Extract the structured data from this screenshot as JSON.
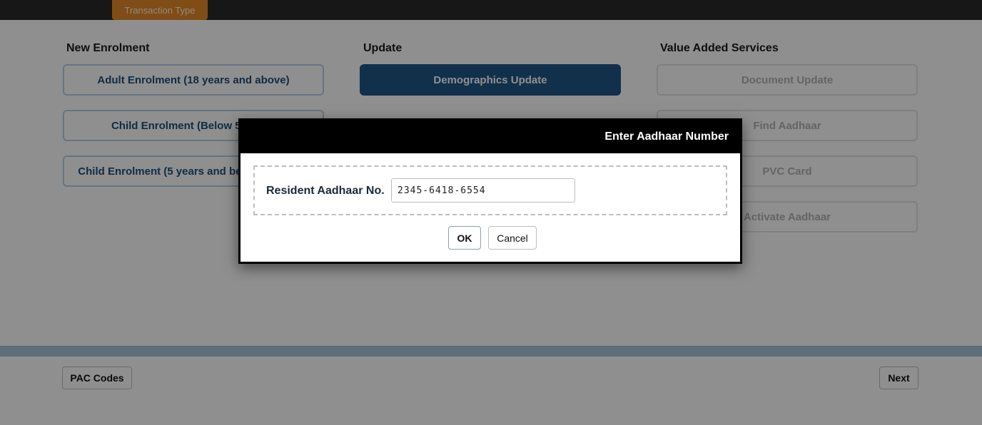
{
  "topbar": {
    "active_tab": "Transaction Type"
  },
  "columns": [
    {
      "heading": "New Enrolment",
      "options": [
        {
          "label": "Adult Enrolment (18 years and above)"
        },
        {
          "label": "Child Enrolment (Below 5 years)"
        },
        {
          "label": "Child Enrolment (5 years and below 18 years)"
        }
      ]
    },
    {
      "heading": "Update",
      "options": [
        {
          "label": "Demographics Update",
          "selected": true
        }
      ]
    },
    {
      "heading": "Value Added Services",
      "options": [
        {
          "label": "Document Update",
          "disabled": true
        },
        {
          "label": "Find Aadhaar",
          "disabled": true
        },
        {
          "label": "PVC Card",
          "disabled": true
        },
        {
          "label": "Activate Aadhaar",
          "disabled": true
        }
      ]
    }
  ],
  "footer": {
    "pac_label": "PAC Codes",
    "next_label": "Next"
  },
  "dialog": {
    "title": "Enter Aadhaar Number",
    "field_label": "Resident Aadhaar No.",
    "field_value": "2345-6418-6554",
    "ok_label": "OK",
    "cancel_label": "Cancel"
  },
  "colors": {
    "accent_orange": "#e58a28",
    "selected_blue": "#1f5688",
    "option_text": "#1e4f7b",
    "topbar": "#2a2a2a"
  }
}
